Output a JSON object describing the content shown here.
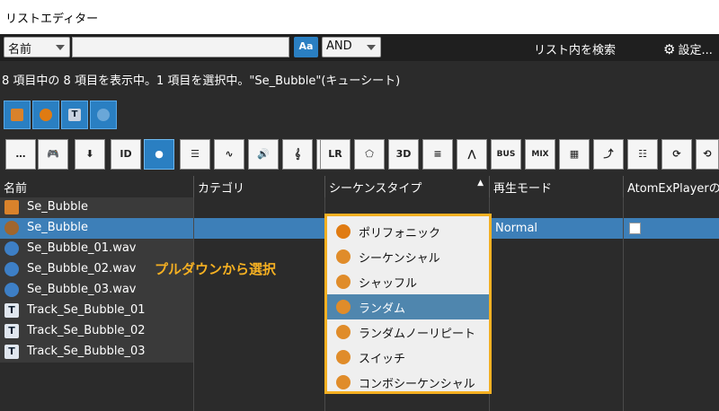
{
  "window": {
    "title": "リストエディター"
  },
  "search": {
    "field_dropdown": "名前",
    "query_value": "",
    "case_button": "Aa",
    "operator_dropdown": "AND",
    "search_in_list": "リスト内を検索",
    "settings": "設定..."
  },
  "status": {
    "text": "8 項目中の 8 項目を表示中。1 項目を選択中。\"Se_Bubble\"(キューシート)"
  },
  "type_filters": [
    {
      "icon": "cue-sheet-icon",
      "color": "#d9822b"
    },
    {
      "icon": "cue-icon",
      "color": "#e07b12"
    },
    {
      "icon": "track-icon",
      "color": "#c8d2e0"
    },
    {
      "icon": "waveform-icon",
      "color": "#6aa7d8"
    }
  ],
  "toolbar": [
    {
      "name": "comment-tool",
      "label": "…"
    },
    {
      "name": "gamepad-tool",
      "label": "🎮"
    },
    {
      "name": "import-tool",
      "label": "⬇"
    },
    {
      "name": "id-tool",
      "label": "ID"
    },
    {
      "name": "cue-type-tool",
      "label": "●"
    },
    {
      "name": "list-tool",
      "label": "☰"
    },
    {
      "name": "wave-tool",
      "label": "∿"
    },
    {
      "name": "volume-tool",
      "label": "🔊"
    },
    {
      "name": "pitch-tool",
      "label": "𝄞"
    },
    {
      "name": "slash-tool",
      "label": "∕"
    },
    {
      "name": "lr-pan-tool",
      "label": "LR"
    },
    {
      "name": "pan3d-tool",
      "label": "⬠"
    },
    {
      "name": "3d-tool",
      "label": "3D"
    },
    {
      "name": "mixer-tool",
      "label": "≡"
    },
    {
      "name": "envelope-tool",
      "label": "⋀"
    },
    {
      "name": "bus-tool",
      "label": "BUS"
    },
    {
      "name": "mix-tool",
      "label": "MIX"
    },
    {
      "name": "block-tool",
      "label": "▦"
    },
    {
      "name": "switch-tool",
      "label": "⤴"
    },
    {
      "name": "param-tool",
      "label": "☷"
    },
    {
      "name": "loop-tool",
      "label": "⟳"
    },
    {
      "name": "more-tool",
      "label": "⟲"
    }
  ],
  "table": {
    "headers": [
      "名前",
      "カテゴリ",
      "シーケンスタイプ",
      "再生モード",
      "AtomExPlayerの"
    ],
    "rows": [
      {
        "name": "Se_Bubble",
        "icon": "cue-sheet-icon",
        "selected": false
      },
      {
        "name": "Se_Bubble",
        "icon": "cue-icon",
        "selected": true
      },
      {
        "name": "Se_Bubble_01.wav",
        "icon": "waveform-icon",
        "selected": false
      },
      {
        "name": "Se_Bubble_02.wav",
        "icon": "waveform-icon",
        "selected": false
      },
      {
        "name": "Se_Bubble_03.wav",
        "icon": "waveform-icon",
        "selected": false
      },
      {
        "name": "Track_Se_Bubble_01",
        "icon": "track-icon",
        "selected": false
      },
      {
        "name": "Track_Se_Bubble_02",
        "icon": "track-icon",
        "selected": false
      },
      {
        "name": "Track_Se_Bubble_03",
        "icon": "track-icon",
        "selected": false
      }
    ],
    "selected_play_mode": "Normal"
  },
  "annotation": {
    "text": "プルダウンから選択",
    "color": "#f5b022"
  },
  "sequence_dropdown": {
    "items": [
      {
        "label": "ポリフォニック",
        "icon": "polyphonic-icon",
        "highlighted": false
      },
      {
        "label": "シーケンシャル",
        "icon": "sequential-icon",
        "highlighted": false
      },
      {
        "label": "シャッフル",
        "icon": "shuffle-icon",
        "highlighted": false
      },
      {
        "label": "ランダム",
        "icon": "random-icon",
        "highlighted": true
      },
      {
        "label": "ランダムノーリピート",
        "icon": "random-no-repeat-icon",
        "highlighted": false
      },
      {
        "label": "スイッチ",
        "icon": "switch-icon",
        "highlighted": false
      },
      {
        "label": "コンボシーケンシャル",
        "icon": "combo-sequential-icon",
        "highlighted": false
      }
    ]
  },
  "colors": {
    "accent": "#2a7fc2",
    "selection": "#3d7fb8",
    "highlight": "#f5b022"
  }
}
